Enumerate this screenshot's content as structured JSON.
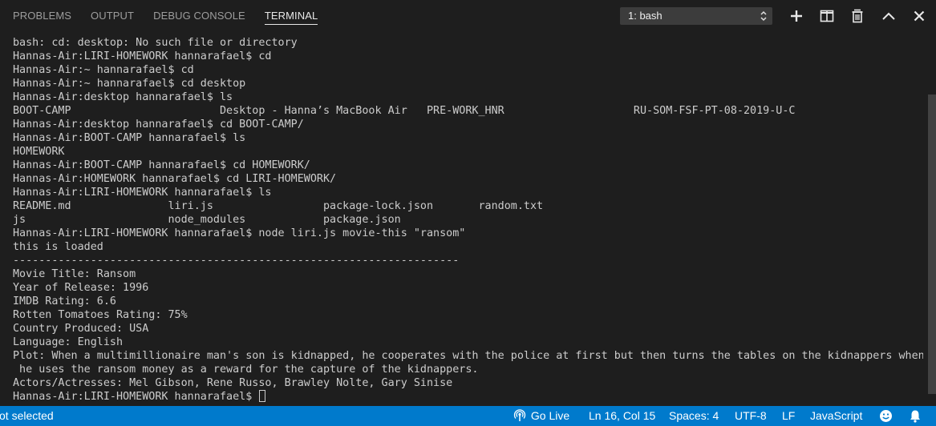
{
  "tabs": [
    "PROBLEMS",
    "OUTPUT",
    "DEBUG CONSOLE",
    "TERMINAL"
  ],
  "active_tab": "TERMINAL",
  "terminal_select": "1: bash",
  "terminal_lines": [
    "bash: cd: desktop: No such file or directory",
    "Hannas-Air:LIRI-HOMEWORK hannarafael$ cd",
    "Hannas-Air:~ hannarafael$ cd",
    "Hannas-Air:~ hannarafael$ cd desktop",
    "Hannas-Air:desktop hannarafael$ ls",
    "BOOT-CAMP                       Desktop - Hanna’s MacBook Air   PRE-WORK_HNR                    RU-SOM-FSF-PT-08-2019-U-C",
    "Hannas-Air:desktop hannarafael$ cd BOOT-CAMP/",
    "Hannas-Air:BOOT-CAMP hannarafael$ ls",
    "HOMEWORK",
    "Hannas-Air:BOOT-CAMP hannarafael$ cd HOMEWORK/",
    "Hannas-Air:HOMEWORK hannarafael$ cd LIRI-HOMEWORK/",
    "Hannas-Air:LIRI-HOMEWORK hannarafael$ ls",
    "README.md               liri.js                 package-lock.json       random.txt",
    "js                      node_modules            package.json",
    "Hannas-Air:LIRI-HOMEWORK hannarafael$ node liri.js movie-this \"ransom\"",
    "this is loaded",
    "---------------------------------------------------------------------",
    "Movie Title: Ransom",
    "Year of Release: 1996",
    "IMDB Rating: 6.6",
    "Rotten Tomatoes Rating: 75%",
    "Country Produced: USA",
    "Language: English",
    "Plot: When a multimillionaire man's son is kidnapped, he cooperates with the police at first but then turns the tables on the kidnappers when",
    " he uses the ransom money as a reward for the capture of the kidnappers.",
    "Actors/Actresses: Mel Gibson, Rene Russo, Brawley Nolte, Gary Sinise",
    "Hannas-Air:LIRI-HOMEWORK hannarafael$ "
  ],
  "status": {
    "left": "ot selected",
    "go_live": "Go Live",
    "position": "Ln 16, Col 15",
    "spaces": "Spaces: 4",
    "encoding": "UTF-8",
    "eol": "LF",
    "language": "JavaScript"
  },
  "icons": {
    "add": "plus-icon",
    "split": "split-icon",
    "kill": "trash-icon",
    "maximize": "chevron-up-icon",
    "close": "close-icon",
    "go_live": "broadcast-icon",
    "feedback": "smiley-icon",
    "notifications": "bell-icon"
  },
  "colors": {
    "panel_bg": "#1e1e1e",
    "statusbar_bg": "#007acc",
    "text": "#cccccc"
  }
}
